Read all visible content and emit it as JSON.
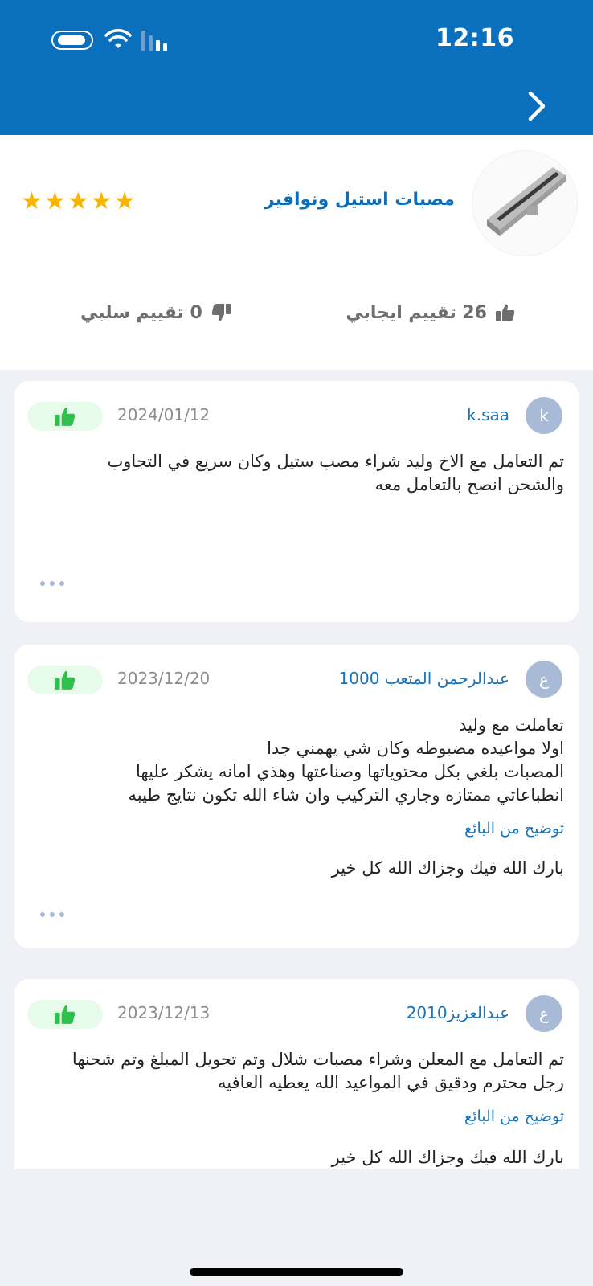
{
  "status_bar": {
    "time": "12:16"
  },
  "seller": {
    "name": "مصبات استيل ونوافير",
    "stars": 5,
    "positive_count_label": "26 تقييم ايجابي",
    "negative_count_label": "0 تقييم سلبي"
  },
  "reviews": [
    {
      "avatar_letter": "k",
      "name": "k.saa",
      "date": "2024/01/12",
      "text": "تم التعامل مع الاخ وليد شراء مصب ستيل وكان سريع في التجاوب\nوالشحن انصح بالتعامل معه"
    },
    {
      "avatar_letter": "ع",
      "name": "عبدالرحمن المتعب 1000",
      "date": "2023/12/20",
      "text": "تعاملت مع وليد\nاولا مواعيده مضبوطه وكان شي يهمني جدا\nالمصبات بلغي بكل محتوياتها وصناعتها وهذي امانه يشكر عليها\nانطباعاتي ممتازه وجاري التركيب وان شاء الله تكون نتايج طيبه",
      "reply_label": "توضيح من البائع",
      "reply_text": "بارك الله فيك وجزاك الله كل خير"
    },
    {
      "avatar_letter": "ع",
      "name": "عبدالعزيز2010",
      "date": "2023/12/13",
      "text": "تم التعامل مع المعلن وشراء مصبات شلال وتم تحويل المبلغ وتم شحنها\nرجل محترم ودقيق في المواعيد الله يعطيه العافيه",
      "reply_label": "توضيح من البائع",
      "reply_text": "بارك الله فيك وجزاك الله كل خير"
    }
  ],
  "colors": {
    "header": "#0a6fbd",
    "accent": "#1a73b8",
    "star": "#f7b500",
    "positive_pill": "#e6fbea",
    "positive_thumb": "#2fbf4a"
  }
}
